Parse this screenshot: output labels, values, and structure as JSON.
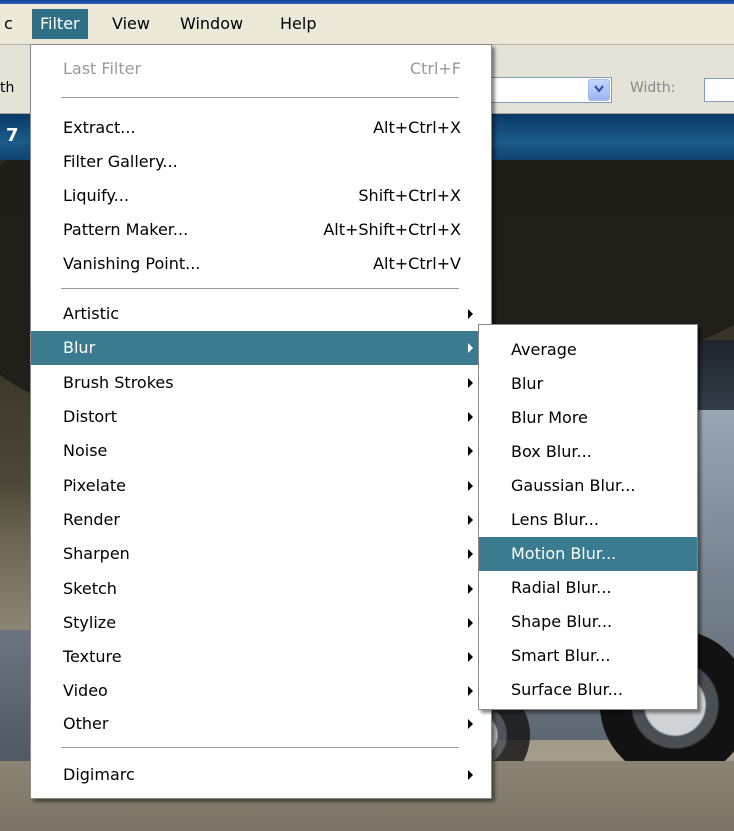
{
  "menubar": {
    "items": [
      {
        "label": "c"
      },
      {
        "label": "Filter"
      },
      {
        "label": "View"
      },
      {
        "label": "Window"
      },
      {
        "label": "Help"
      }
    ]
  },
  "options": {
    "leading_text": "th",
    "width_label": "Width:"
  },
  "document": {
    "title_fragment": "7"
  },
  "filter_menu": {
    "items": [
      {
        "label": "Last Filter",
        "shortcut": "Ctrl+F"
      },
      {
        "label": "Extract...",
        "shortcut": "Alt+Ctrl+X"
      },
      {
        "label": "Filter Gallery..."
      },
      {
        "label": "Liquify...",
        "shortcut": "Shift+Ctrl+X"
      },
      {
        "label": "Pattern Maker...",
        "shortcut": "Alt+Shift+Ctrl+X"
      },
      {
        "label": "Vanishing Point...",
        "shortcut": "Alt+Ctrl+V"
      },
      {
        "label": "Artistic"
      },
      {
        "label": "Blur"
      },
      {
        "label": "Brush Strokes"
      },
      {
        "label": "Distort"
      },
      {
        "label": "Noise"
      },
      {
        "label": "Pixelate"
      },
      {
        "label": "Render"
      },
      {
        "label": "Sharpen"
      },
      {
        "label": "Sketch"
      },
      {
        "label": "Stylize"
      },
      {
        "label": "Texture"
      },
      {
        "label": "Video"
      },
      {
        "label": "Other"
      },
      {
        "label": "Digimarc"
      }
    ]
  },
  "blur_submenu": {
    "items": [
      {
        "label": "Average"
      },
      {
        "label": "Blur"
      },
      {
        "label": "Blur More"
      },
      {
        "label": "Box Blur..."
      },
      {
        "label": "Gaussian Blur..."
      },
      {
        "label": "Lens Blur..."
      },
      {
        "label": "Motion Blur..."
      },
      {
        "label": "Radial Blur..."
      },
      {
        "label": "Shape Blur..."
      },
      {
        "label": "Smart Blur..."
      },
      {
        "label": "Surface Blur..."
      }
    ]
  },
  "colors": {
    "highlight": "#3a7b8f",
    "menubar_active": "#2f6f86"
  }
}
